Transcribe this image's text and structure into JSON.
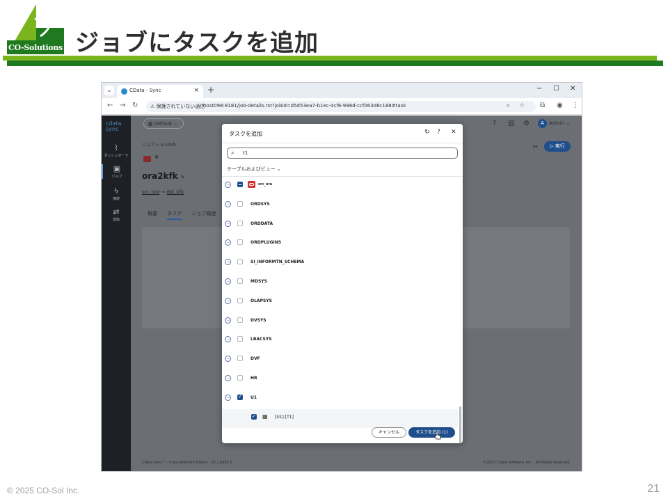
{
  "slide": {
    "logo_text": "CO-Solutions",
    "title": "ジョブにタスクを追加",
    "copyright": "© 2025 CO-Sol Inc.",
    "page_number": "21",
    "colors": {
      "green": "#7ab51d",
      "dark_green": "#1f7a1f"
    }
  },
  "browser": {
    "tab_title": "CData - Sync",
    "tab_close": "×",
    "new_tab": "+",
    "window_controls": [
      "−",
      "☐",
      "✕"
    ],
    "security_label": "保護されていない通信",
    "url": "host098:8181/job-details.rst?jobid=d5d53ea7-b1ec-4cf6-998d-ccf063d8c188#task"
  },
  "app": {
    "logo_line1": "cdata",
    "logo_line2": "sync",
    "sidebar": [
      {
        "label": "ダッシュボード",
        "icon": "chart-icon"
      },
      {
        "label": "ジョブ",
        "icon": "briefcase-icon"
      },
      {
        "label": "接続",
        "icon": "plug-icon"
      },
      {
        "label": "変換",
        "icon": "transform-icon"
      }
    ],
    "workspace": "Default",
    "user_initial": "A",
    "user_name": "Admin",
    "breadcrumb": "ジョブ > ora2kfk",
    "job_name": "ora2kfk",
    "source": "src_ora",
    "arrow": "→",
    "destination": "dst_kfk",
    "tabs": [
      "概要",
      "タスク",
      "ジョブ履歴"
    ],
    "run_button": "▷ 実行",
    "footer_left": "CData Sync™ - Cross-Platform Edition - 25.1.9242.0",
    "footer_right": "©2025 CData Software, Inc. - All Rights Reserved."
  },
  "modal": {
    "title": "タスクを追加",
    "search_value": "t1",
    "filter_label": "テーブルおよびビュー",
    "connection": "src_ora",
    "schemas": [
      "ORDSYS",
      "ORDDATA",
      "ORDPLUGINS",
      "SI_INFORMTN_SCHEMA",
      "MDSYS",
      "OLAPSYS",
      "DVSYS",
      "LBACSYS",
      "DVF",
      "HR",
      "U1"
    ],
    "table_item": "[U1].[T1]",
    "cancel_label": "キャンセル",
    "add_label": "タスクを追加 (1)"
  }
}
